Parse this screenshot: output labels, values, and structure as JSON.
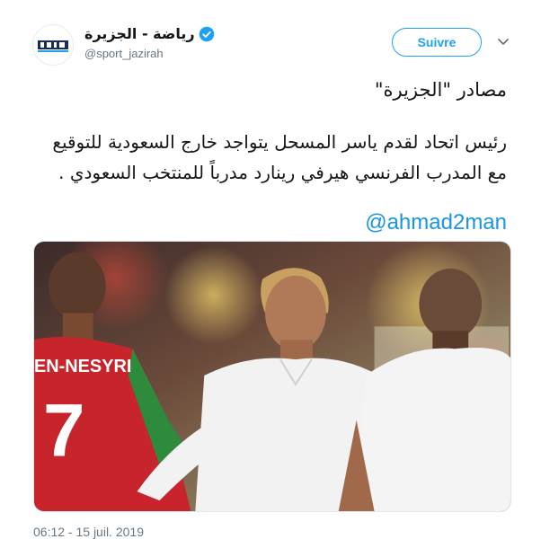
{
  "account": {
    "display_name": "رياضة - الجزيرة",
    "handle": "@sport_jazirah",
    "avatar_logo_text": "الجزيرة",
    "verified": true
  },
  "follow_label": "Suivre",
  "tweet": {
    "line1": "مصادر \"الجزيرة\"",
    "line2": "رئيس اتحاد لقدم ياسر المسحل يتواجد خارج السعودية للتوقيع",
    "line3": "مع المدرب الفرنسي هيرفي رينارد مدرباً للمنتخب السعودي .",
    "mention": "@ahmad2man"
  },
  "photo": {
    "jersey_name": "EN-NESYRI",
    "jersey_number": "7"
  },
  "timestamp": "06:12 - 15 juil. 2019",
  "colors": {
    "accent": "#1da1f2",
    "mention": "#1b95e0",
    "secondary_text": "#657786",
    "jersey_red": "#c8242c",
    "jersey_green": "#2e8b3c"
  }
}
